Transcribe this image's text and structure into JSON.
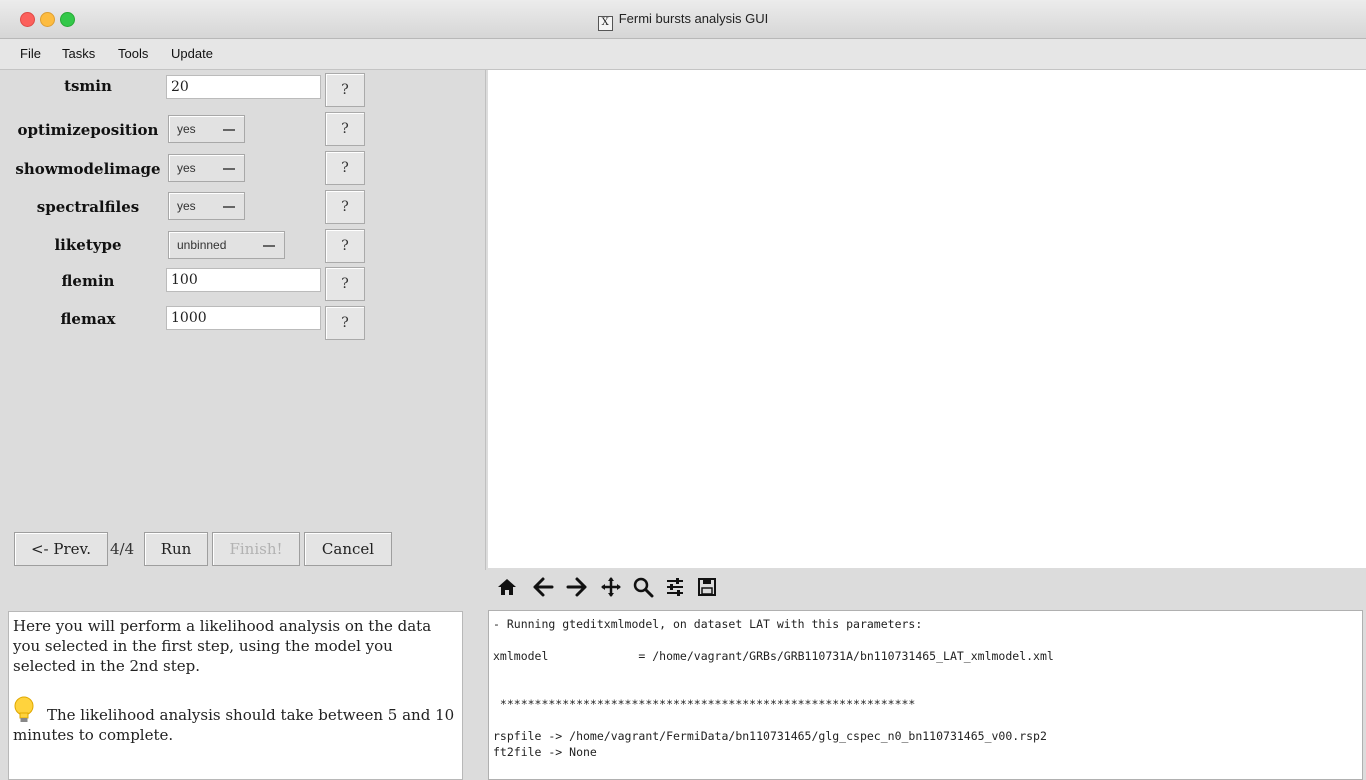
{
  "window": {
    "title": "Fermi bursts analysis GUI",
    "x_icon": "X"
  },
  "menu": [
    {
      "label": "File"
    },
    {
      "label": "Tasks"
    },
    {
      "label": "Tools"
    },
    {
      "label": "Update"
    }
  ],
  "params": {
    "tsmin": {
      "label": "tsmin",
      "value": "20"
    },
    "optimizeposition": {
      "label": "optimizeposition",
      "value": "yes"
    },
    "showmodelimage": {
      "label": "showmodelimage",
      "value": "yes"
    },
    "spectralfiles": {
      "label": "spectralfiles",
      "value": "yes"
    },
    "liketype": {
      "label": "liketype",
      "value": "unbinned"
    },
    "flemin": {
      "label": "flemin",
      "value": "100"
    },
    "flemax": {
      "label": "flemax",
      "value": "1000"
    },
    "help_label": "?"
  },
  "nav": {
    "prev": "<- Prev.",
    "step": "4/4",
    "run": "Run",
    "finish": "Finish!",
    "cancel": "Cancel"
  },
  "info": {
    "paragraph1": "Here you will perform a likelihood analysis on the data you selected in the first step, using the model you selected in the 2nd step.",
    "paragraph2": "The likelihood analysis should take between 5 and 10 minutes to complete."
  },
  "toolbar": {
    "icons": [
      "home-icon",
      "back-arrow-icon",
      "forward-arrow-icon",
      "pan-icon",
      "zoom-icon",
      "configure-subplots-icon",
      "save-icon"
    ]
  },
  "console": {
    "lines": [
      "- Running gteditxmlmodel, on dataset LAT with this parameters:",
      "",
      "xmlmodel             = /home/vagrant/GRBs/GRB110731A/bn110731465_LAT_xmlmodel.xml",
      "",
      "",
      " ************************************************************",
      "",
      "rspfile -> /home/vagrant/FermiData/bn110731465/glg_cspec_n0_bn110731465_v00.rsp2",
      "ft2file -> None"
    ]
  }
}
